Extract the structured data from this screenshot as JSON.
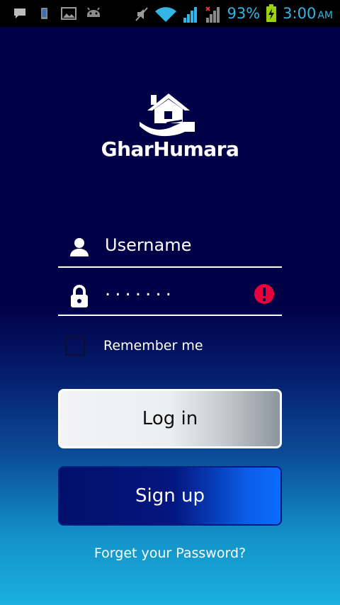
{
  "status_bar": {
    "battery_percent": "93%",
    "time": "3:00",
    "ampm": "AM",
    "icons": [
      "chat-icon",
      "phone-icon",
      "image-icon",
      "android-icon",
      "mute-icon",
      "wifi-icon",
      "signal-icon",
      "signal-x-icon",
      "battery-charging-icon"
    ]
  },
  "logo": {
    "text": "GharHumara"
  },
  "login_form": {
    "username_label": "Username",
    "password_value": ".......",
    "remember_label": "Remember me",
    "login_label": "Log in",
    "signup_label": "Sign up",
    "forgot_label": "Forget your Password?"
  },
  "colors": {
    "background_top": "#000046",
    "background_bottom": "#1bb0de",
    "status_text": "#33b5e5",
    "error": "#e8003d"
  }
}
